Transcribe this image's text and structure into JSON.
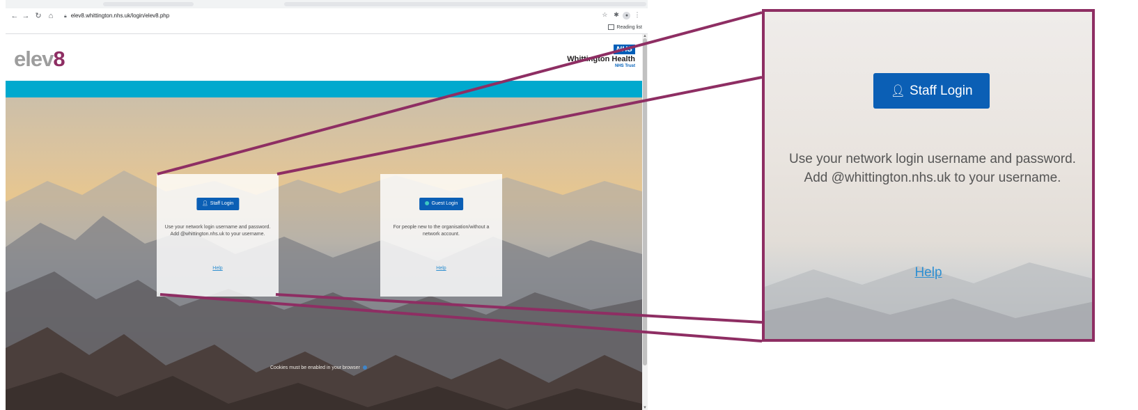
{
  "browser": {
    "url": "elev8.whittington.nhs.uk/login/elev8.php",
    "reading_list_label": "Reading list",
    "icons": [
      "back-icon",
      "forward-icon",
      "reload-icon",
      "home-icon",
      "lock-icon",
      "star-icon",
      "extensions-icon",
      "profile-icon",
      "menu-icon"
    ]
  },
  "header": {
    "logo_text": "elev",
    "logo_number": "8",
    "nhs_badge": "NHS",
    "org_name": "Whittington Health",
    "trust_label": "NHS Trust"
  },
  "staff_card": {
    "button_label": "Staff Login",
    "description": "Use your network login username and password. Add @whittington.nhs.uk to your username.",
    "help_label": "Help"
  },
  "guest_card": {
    "button_label": "Guest Login",
    "description": "For people new to the organisation/without a network account.",
    "help_label": "Help"
  },
  "footer": {
    "cookies_notice": "Cookies must be enabled in your browser"
  },
  "zoom": {
    "button_label": "Staff Login",
    "description": "Use your network login username and password. Add @whittington.nhs.uk to your username.",
    "help_label": "Help"
  },
  "colors": {
    "brand_purple": "#8e2e63",
    "nhs_blue": "#005eb8",
    "teal_band": "#00a9ce",
    "button_blue": "#0b5fb5"
  }
}
